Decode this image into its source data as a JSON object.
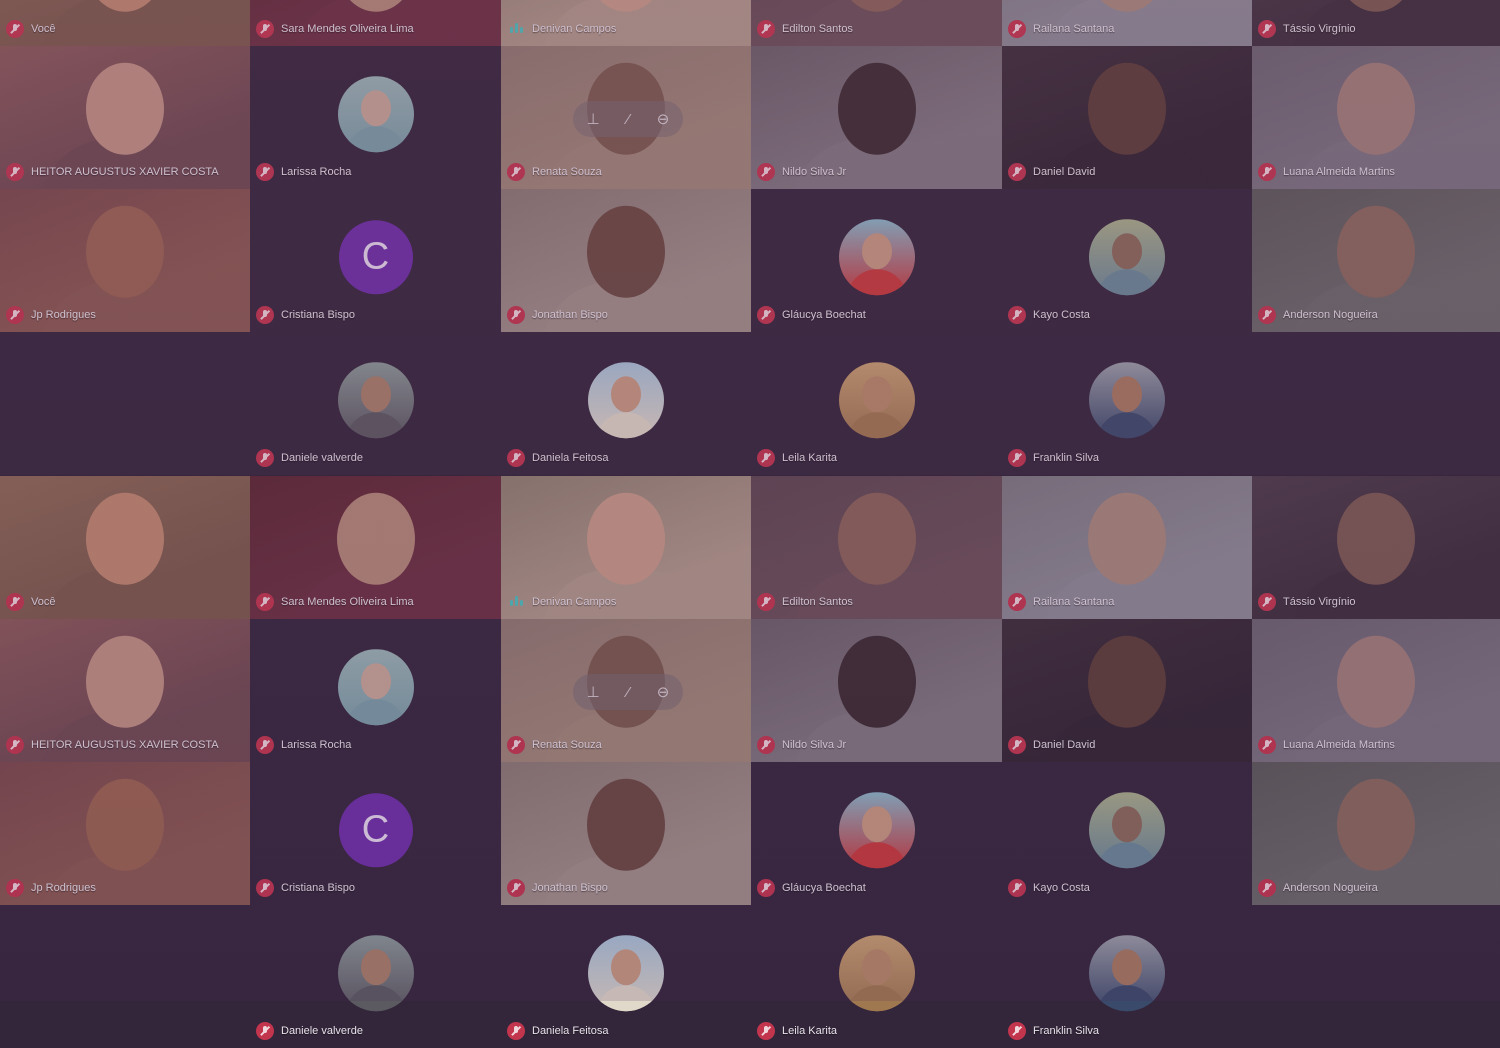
{
  "meeting": {
    "participants": [
      {
        "name": "Você",
        "type": "video",
        "palette": [
          "#8c6a55",
          "#7b5a4a",
          "#c08a6e"
        ]
      },
      {
        "name": "Sara Mendes Oliveira Lima",
        "type": "video",
        "palette": [
          "#5a2830",
          "#6a3040",
          "#b48a78"
        ]
      },
      {
        "name": "Denivan Campos",
        "type": "video",
        "speaking": true,
        "palette": [
          "#8f8070",
          "#b09a8a",
          "#c89c88"
        ]
      },
      {
        "name": "Edilton Santos",
        "type": "video",
        "palette": [
          "#5c4850",
          "#6a5058",
          "#8a6458"
        ]
      },
      {
        "name": "Railana Santana",
        "type": "video",
        "palette": [
          "#7c7a80",
          "#8c8c96",
          "#a88a7c"
        ]
      },
      {
        "name": "Tássio Virgínio",
        "type": "video",
        "palette": [
          "#4a3c48",
          "#3a2e3a",
          "#7a5a50"
        ]
      },
      {
        "name": "HEITOR AUGUSTUS XAVIER COSTA",
        "type": "video",
        "palette": [
          "#8a5a58",
          "#6e4a50",
          "#c09282"
        ]
      },
      {
        "name": "Larissa Rocha",
        "type": "avatar",
        "palette": [
          "#9ab6b6",
          "#7aa0a8",
          "#c8a898"
        ]
      },
      {
        "name": "Renata Souza",
        "type": "video",
        "hover": true,
        "palette": [
          "#907a70",
          "#a08878",
          "#7a5a4c"
        ]
      },
      {
        "name": "Nildo Silva Jr",
        "type": "video",
        "palette": [
          "#6a6068",
          "#807880",
          "#3a2c30"
        ]
      },
      {
        "name": "Daniel David",
        "type": "video",
        "palette": [
          "#3a2e38",
          "#2e2430",
          "#5a3e36"
        ]
      },
      {
        "name": "Luana Almeida Martins",
        "type": "video",
        "palette": [
          "#6a6470",
          "#7a7480",
          "#a08078"
        ]
      },
      {
        "name": "Jp Rodrigues",
        "type": "video",
        "palette": [
          "#7a4a4a",
          "#8a5a50",
          "#9a6450"
        ]
      },
      {
        "name": "Cristiana Bispo",
        "type": "letter",
        "letter": "C"
      },
      {
        "name": "Jonathan Bispo",
        "type": "video",
        "palette": [
          "#8a7a74",
          "#a09088",
          "#6a4a40"
        ]
      },
      {
        "name": "Gláucya Boechat",
        "type": "avatar",
        "palette": [
          "#8ab8c8",
          "#c83a3a",
          "#c89a80"
        ]
      },
      {
        "name": "Kayo Costa",
        "type": "avatar",
        "palette": [
          "#a8b08a",
          "#6a8a98",
          "#8a6a58"
        ]
      },
      {
        "name": "Anderson Nogueira",
        "type": "video",
        "palette": [
          "#5a5a58",
          "#6a6a6a",
          "#8a6a5c"
        ]
      },
      {
        "name": "",
        "type": "empty"
      },
      {
        "name": "Daniele valverde",
        "type": "avatar",
        "palette": [
          "#8a9a98",
          "#5a5a60",
          "#a88068"
        ]
      },
      {
        "name": "Daniela Feitosa",
        "type": "avatar",
        "palette": [
          "#a8c4d8",
          "#e0d8c8",
          "#c89a80"
        ]
      },
      {
        "name": "Leila Karita",
        "type": "avatar",
        "palette": [
          "#c8a070",
          "#a07850",
          "#b88a68"
        ]
      },
      {
        "name": "Franklin Silva",
        "type": "avatar",
        "palette": [
          "#9aa0a8",
          "#3a4a6a",
          "#a87a60"
        ]
      },
      {
        "name": "",
        "type": "empty"
      }
    ]
  }
}
